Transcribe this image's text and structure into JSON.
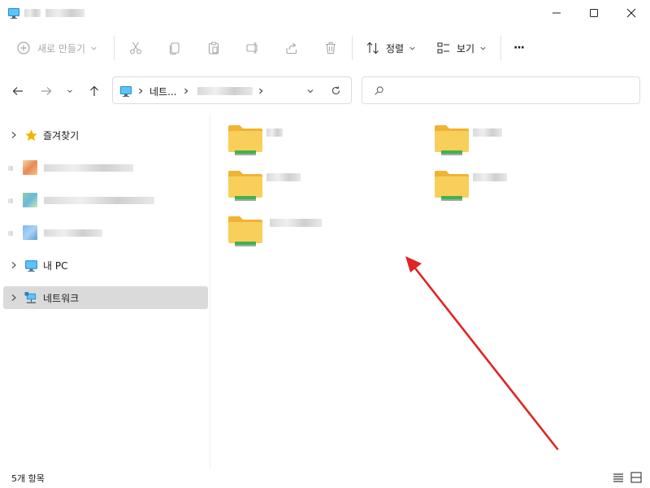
{
  "toolbar": {
    "new_label": "새로 만들기",
    "sort_label": "정렬",
    "view_label": "보기",
    "more_label": "···"
  },
  "address": {
    "path_root": "네트..."
  },
  "sidebar": {
    "items": [
      {
        "label": "즐겨찾기"
      },
      {
        "label": "내 PC"
      },
      {
        "label": "네트워크"
      }
    ]
  },
  "status": {
    "item_count": "5개 항목"
  },
  "colors": {
    "folder_body": "#f8cf5a",
    "folder_tab": "#f2b233",
    "folder_stripe": "#3fb44b",
    "selection": "#dadada",
    "arrow": "#e02424",
    "star": "#f5b400",
    "pc_monitor": "#1f8fd6"
  },
  "icons": {
    "titlebar": "pc-monitor-icon",
    "favorites": "star-icon",
    "this_pc": "pc-monitor-icon",
    "network": "network-icon",
    "search": "search-icon"
  }
}
